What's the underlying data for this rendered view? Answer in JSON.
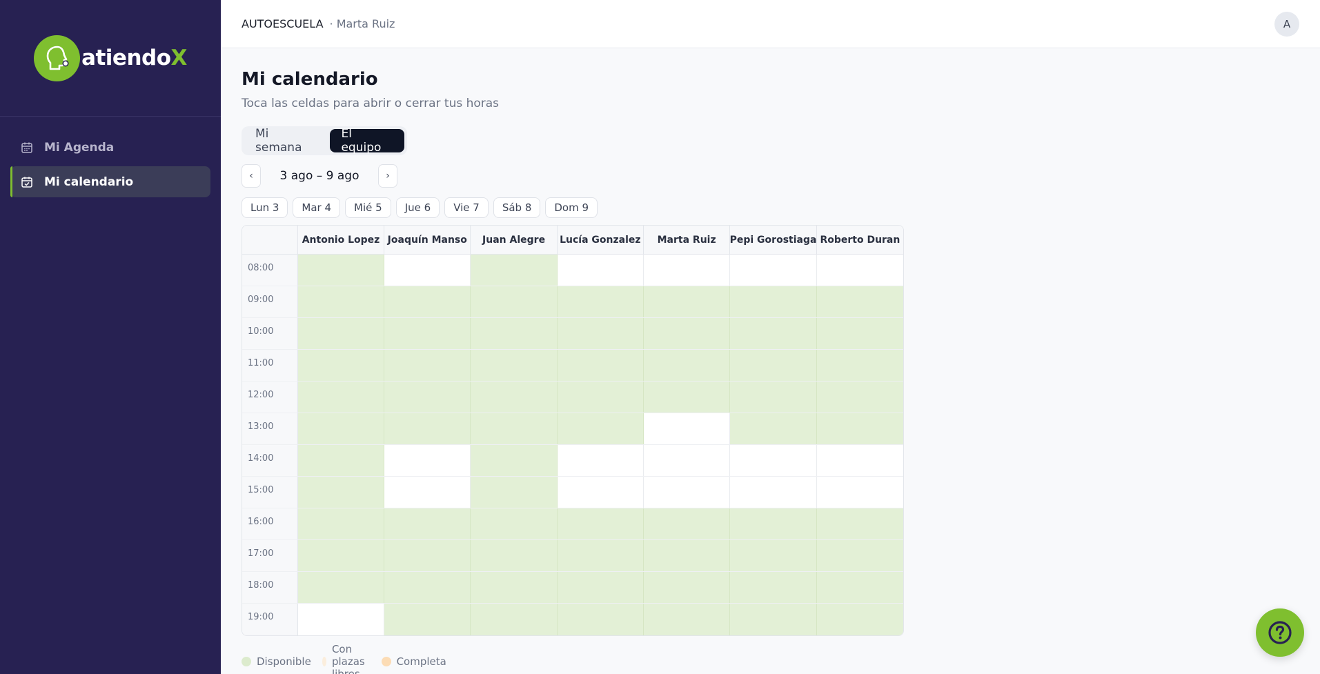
{
  "brand": {
    "logo_text": "atiendo",
    "logo_x": "X",
    "accent": "#7fbf2f"
  },
  "sidebar": {
    "items": [
      {
        "label": "Mi Agenda",
        "icon": "calendar-icon",
        "active": false
      },
      {
        "label": "Mi calendario",
        "icon": "calendar-check-icon",
        "active": true
      }
    ]
  },
  "header": {
    "org": "AUTOESCUELA",
    "user": "· Marta Ruiz",
    "avatar_initial": "A"
  },
  "page": {
    "title": "Mi calendario",
    "subtitle": "Toca las celdas para abrir o cerrar tus horas"
  },
  "tabs": [
    {
      "label": "Mi semana",
      "active": false
    },
    {
      "label": "El equipo",
      "active": true
    }
  ],
  "week": {
    "prev": "‹",
    "range": "3 ago – 9 ago",
    "next": "›"
  },
  "days": [
    "Lun 3",
    "Mar 4",
    "Mié 5",
    "Jue 6",
    "Vie 7",
    "Sáb 8",
    "Dom 9"
  ],
  "grid": {
    "columns": [
      "Antonio Lopez",
      "Joaquín Manso",
      "Juan Alegre",
      "Lucía Gonzalez",
      "Marta Ruiz",
      "Pepi Gorostiaga",
      "Roberto Duran"
    ],
    "rows": [
      {
        "time": "08:00",
        "cells": [
          1,
          0,
          1,
          0,
          0,
          0,
          0
        ]
      },
      {
        "time": "09:00",
        "cells": [
          1,
          1,
          1,
          1,
          1,
          1,
          1
        ]
      },
      {
        "time": "10:00",
        "cells": [
          1,
          1,
          1,
          1,
          1,
          1,
          1
        ]
      },
      {
        "time": "11:00",
        "cells": [
          1,
          1,
          1,
          1,
          1,
          1,
          1
        ]
      },
      {
        "time": "12:00",
        "cells": [
          1,
          1,
          1,
          1,
          1,
          1,
          1
        ]
      },
      {
        "time": "13:00",
        "cells": [
          1,
          1,
          1,
          1,
          0,
          1,
          1
        ]
      },
      {
        "time": "14:00",
        "cells": [
          1,
          0,
          1,
          0,
          0,
          0,
          0
        ]
      },
      {
        "time": "15:00",
        "cells": [
          1,
          0,
          1,
          0,
          0,
          0,
          0
        ]
      },
      {
        "time": "16:00",
        "cells": [
          1,
          1,
          1,
          1,
          1,
          1,
          1
        ]
      },
      {
        "time": "17:00",
        "cells": [
          1,
          1,
          1,
          1,
          1,
          1,
          1
        ]
      },
      {
        "time": "18:00",
        "cells": [
          1,
          1,
          1,
          1,
          1,
          1,
          1
        ]
      },
      {
        "time": "19:00",
        "cells": [
          0,
          1,
          1,
          1,
          1,
          1,
          1
        ]
      }
    ]
  },
  "legend": [
    {
      "label": "Disponible",
      "color": "#dcebcd"
    },
    {
      "label": "Con plazas libres",
      "color": "#fbeedd"
    },
    {
      "label": "Completa",
      "color": "#fcdcb5"
    }
  ]
}
